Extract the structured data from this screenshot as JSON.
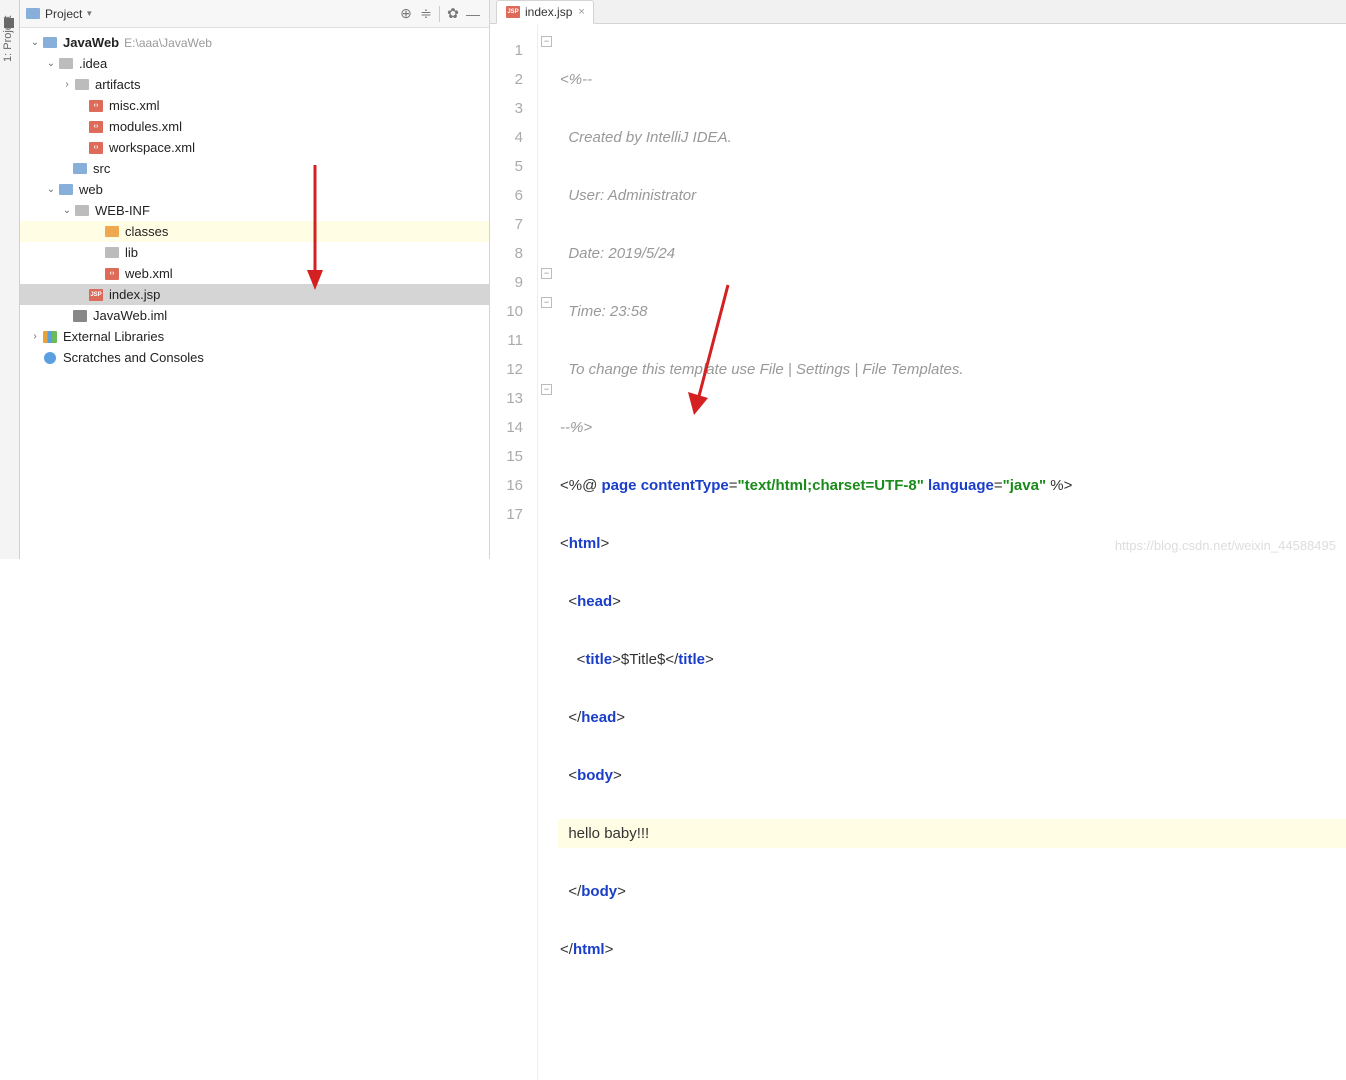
{
  "panel": {
    "title": "Project"
  },
  "tree": {
    "root": {
      "name": "JavaWeb",
      "path": "E:\\aaa\\JavaWeb"
    },
    "idea": ".idea",
    "artifacts": "artifacts",
    "misc": "misc.xml",
    "modules": "modules.xml",
    "workspace": "workspace.xml",
    "src": "src",
    "web": "web",
    "webinf": "WEB-INF",
    "classes": "classes",
    "lib": "lib",
    "webxml": "web.xml",
    "index": "index.jsp",
    "iml": "JavaWeb.iml",
    "ext": "External Libraries",
    "scratch": "Scratches and Consoles"
  },
  "tab": {
    "name": "index.jsp",
    "close": "×"
  },
  "gutter": [
    "1",
    "2",
    "3",
    "4",
    "5",
    "6",
    "7",
    "8",
    "9",
    "10",
    "11",
    "12",
    "13",
    "14",
    "15",
    "16",
    "17"
  ],
  "code": {
    "l1": "<%--",
    "l2": "  Created by IntelliJ IDEA.",
    "l3": "  User: Administrator",
    "l4": "  Date: 2019/5/24",
    "l5": "  Time: 23:58",
    "l6": "  To change this template use File | Settings | File Templates.",
    "l7": "--%>",
    "l8a": "<%@ ",
    "l8b": "page ",
    "l8c": "contentType",
    "l8d": "=",
    "l8e": "\"text/html;charset=UTF-8\"",
    "l8f": " language",
    "l8g": "=",
    "l8h": "\"java\"",
    "l8i": " %>",
    "l9a": "<",
    "l9b": "html",
    "l9c": ">",
    "l10a": "  <",
    "l10b": "head",
    "l10c": ">",
    "l11a": "    <",
    "l11b": "title",
    "l11c": ">",
    "l11d": "$Title$",
    "l11e": "</",
    "l11f": "title",
    "l11g": ">",
    "l12a": "  </",
    "l12b": "head",
    "l12c": ">",
    "l13a": "  <",
    "l13b": "body",
    "l13c": ">",
    "l14": "  hello baby!!!",
    "l15a": "  </",
    "l15b": "body",
    "l15c": ">",
    "l16a": "</",
    "l16b": "html",
    "l16c": ">"
  },
  "sidebar_label": "1: Project",
  "watermark": "https://blog.csdn.net/weixin_44588495"
}
